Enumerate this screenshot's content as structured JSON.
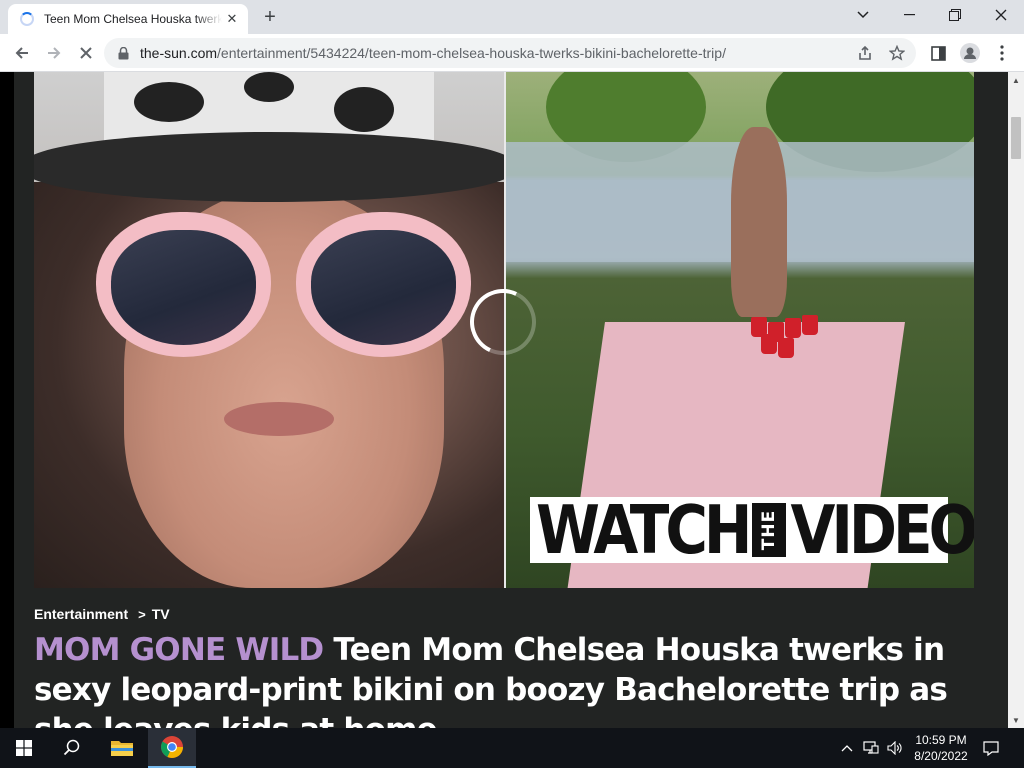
{
  "browser": {
    "tab": {
      "title": "Teen Mom Chelsea Houska twerks in sexy leopard-print bikini",
      "close_label": "✕"
    },
    "new_tab_label": "+",
    "address": {
      "domain": "the-sun.com",
      "path": "/entertainment/5434224/teen-mom-chelsea-houska-twerks-bikini-bachelorette-trip/"
    },
    "icons": [
      "back-icon",
      "forward-icon",
      "stop-icon",
      "lock-icon",
      "share-icon",
      "star-icon",
      "sidepanel-icon",
      "profile-icon",
      "menu-icon"
    ]
  },
  "article": {
    "video": {
      "overlay_watch": "WATCH",
      "overlay_the": "THE",
      "overlay_video": "VIDEO"
    },
    "breadcrumb": {
      "section": "Entertainment",
      "separator": ">",
      "subsection": "TV"
    },
    "headline": {
      "kicker": "MOM GONE WILD",
      "text": " Teen Mom Chelsea Houska twerks in sexy leopard-print bikini on boozy Bachelorette trip as she leaves kids at home"
    },
    "colors": {
      "kicker": "#b590cf",
      "background": "#222423"
    }
  },
  "taskbar": {
    "time": "10:59 PM",
    "date": "8/20/2022",
    "apps": [
      "windows-start-icon",
      "search-icon",
      "file-explorer-icon",
      "chrome-icon"
    ],
    "tray": [
      "chevron-up-icon",
      "network-icon",
      "volume-icon",
      "notification-icon"
    ]
  }
}
